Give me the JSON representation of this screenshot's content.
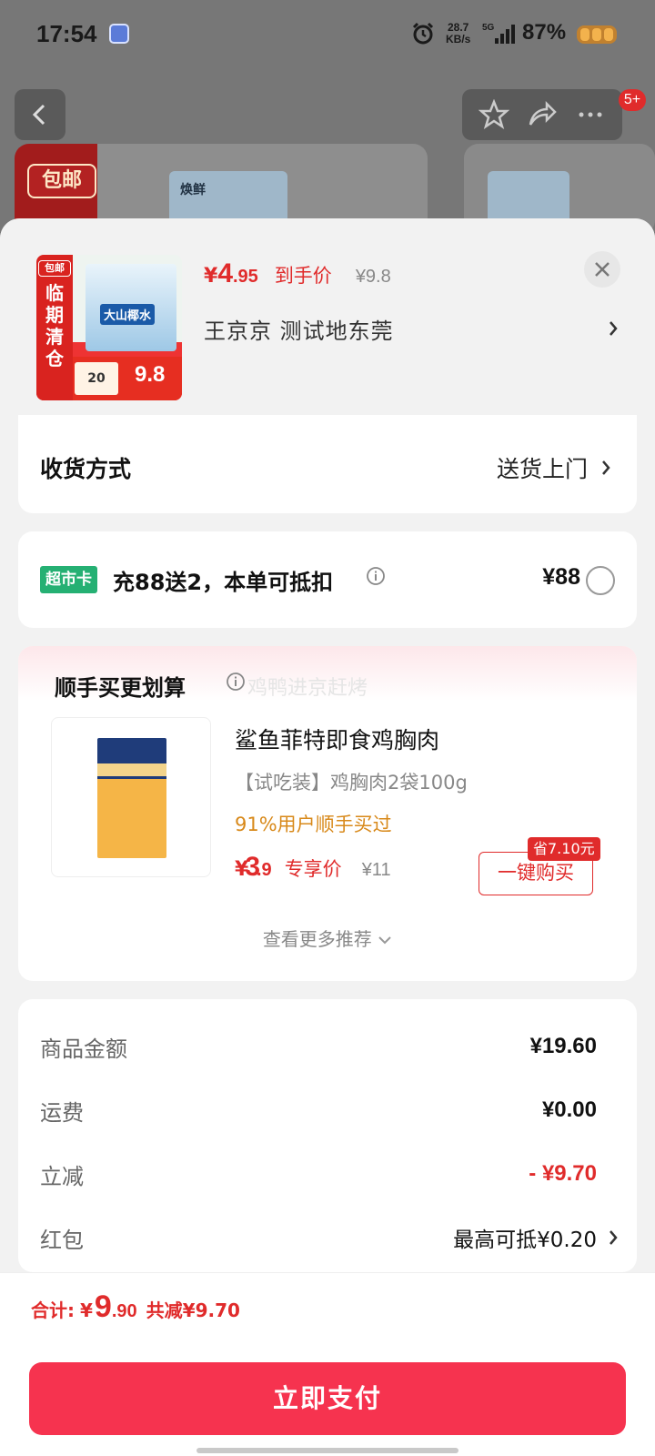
{
  "status_bar": {
    "time": "17:54",
    "net_speed": "28.7",
    "net_unit": "KB/s",
    "network": "5G",
    "battery": "87%"
  },
  "header": {
    "badge": "5+",
    "bg_tag": "包邮",
    "bg_box_label": "焕鲜"
  },
  "product": {
    "currency": "¥",
    "price_int": "4",
    "price_dec": ".95",
    "price_label": "到手价",
    "original_price": "¥9.8",
    "address": "王京京  测试地东莞",
    "thumb": {
      "tag": "包邮",
      "vertical_text": "临期清仓",
      "box_label": "大山椰水",
      "compare_price": "20",
      "price": "9.8"
    }
  },
  "delivery": {
    "label": "收货方式",
    "value": "送货上门"
  },
  "super_card": {
    "badge": "超市卡",
    "text": "充88送2，本单可抵扣",
    "amount": "¥88"
  },
  "recommend": {
    "title": "顺手买更划算",
    "ghost_text": "鸡鸭进京赶烤",
    "product_name": "鲨鱼菲特即食鸡胸肉",
    "spec": "【试吃装】鸡胸肉2袋100g",
    "bought": "91%用户顺手买过",
    "currency": "¥",
    "price_int": "3",
    "price_dec": ".9",
    "price_label": "专享价",
    "original_price": "¥11",
    "save_tag": "省7.10元",
    "buy_button": "一键购买",
    "more": "查看更多推荐"
  },
  "summary": {
    "rows": [
      {
        "label": "商品金额",
        "value": "¥19.60"
      },
      {
        "label": "运费",
        "value": "¥0.00"
      },
      {
        "label": "立减",
        "value": "- ¥9.70"
      },
      {
        "label": "红包",
        "value": "最高可抵¥0.20"
      }
    ]
  },
  "footer": {
    "total_label": "合计:",
    "currency": "¥",
    "total_int": "9",
    "total_dec": ".90",
    "saved": "共减¥9.70",
    "pay_button": "立即支付"
  },
  "colors": {
    "accent_red": "#e02b2b",
    "pay_button": "#f6334f",
    "super_badge": "#25b073",
    "bought_text": "#d8891a"
  }
}
